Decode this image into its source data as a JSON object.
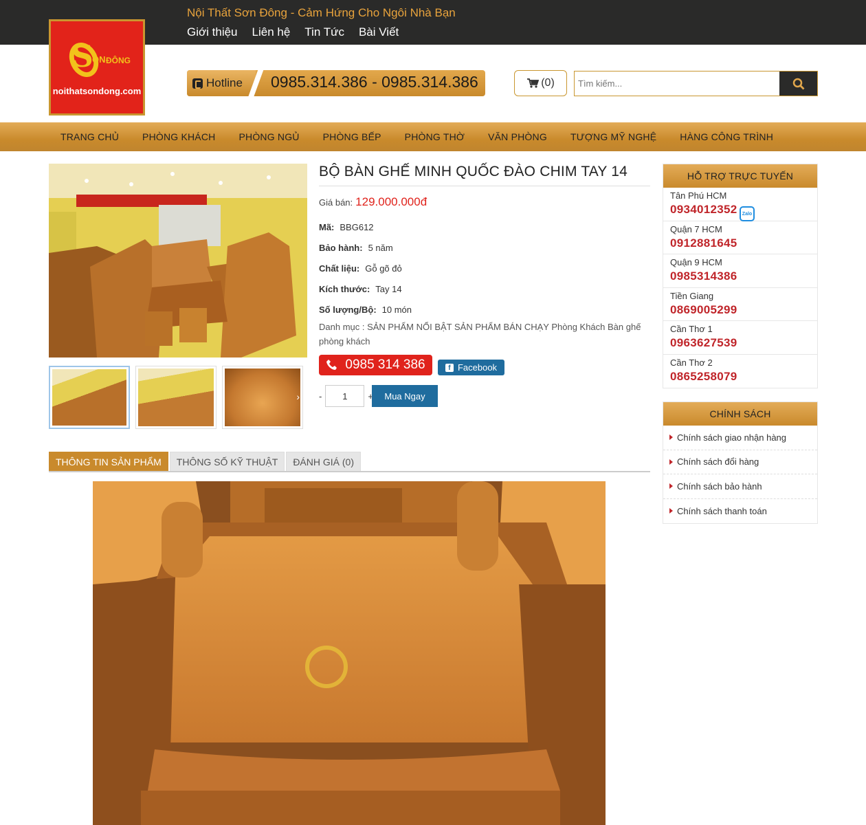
{
  "header": {
    "tagline": "Nội Thất Sơn Đông - Cảm Hứng Cho Ngôi Nhà Bạn",
    "top_links": [
      "Giới thiệu",
      "Liên hệ",
      "Tin Tức",
      "Bài Viết"
    ],
    "logo": {
      "brand_s": "S",
      "brand_on": "ON",
      "brand_dong": "ĐÔNG",
      "site": "noithatsondong.com"
    },
    "hotline_label": "Hotline",
    "hotline_numbers": "0985.314.386 - 0985.314.386",
    "cart_count": "(0)",
    "search_placeholder": "Tìm kiếm..."
  },
  "main_nav": [
    "TRANG CHỦ",
    "PHÒNG KHÁCH",
    "PHÒNG NGỦ",
    "PHÒNG BẾP",
    "PHÒNG THỜ",
    "VĂN PHÒNG",
    "TƯỢNG MỸ NGHỆ",
    "HÀNG CÔNG TRÌNH"
  ],
  "product": {
    "title": "BỘ BÀN GHẾ MINH QUỐC ĐÀO CHIM TAY 14",
    "price_label": "Giá bán:",
    "price": "129.000.000đ",
    "attributes": [
      {
        "key": "Mã:",
        "value": "BBG612"
      },
      {
        "key": "Bảo hành:",
        "value": "5 năm"
      },
      {
        "key": "Chất liệu:",
        "value": "Gỗ gõ đỏ"
      },
      {
        "key": "Kích thước:",
        "value": "Tay 14"
      },
      {
        "key": "Số lượng/Bộ:",
        "value": "10 món"
      }
    ],
    "category_text": "Danh mục : SẢN PHẨM NỔI BẬT SẢN PHẨM BÁN CHẠY Phòng Khách Bàn ghế phòng khách",
    "call_button": "0985 314 386",
    "facebook_button": "Facebook",
    "qty_minus": "-",
    "qty_value": "1",
    "qty_plus": "+",
    "buy_button": "Mua Ngay"
  },
  "tabs": [
    "THÔNG TIN SẢN PHẨM",
    "THÔNG SỐ KỸ THUẬT",
    "ĐÁNH GIÁ (0)"
  ],
  "support": {
    "title": "HỖ TRỢ TRỰC TUYẾN",
    "zalo_label": "Zalo",
    "items": [
      {
        "region": "Tân Phú HCM",
        "phone": "0934012352"
      },
      {
        "region": "Quận 7 HCM",
        "phone": "0912881645"
      },
      {
        "region": "Quận 9 HCM",
        "phone": "0985314386"
      },
      {
        "region": "Tiền Giang",
        "phone": "0869005299"
      },
      {
        "region": "Cần Thơ 1",
        "phone": "0963627539"
      },
      {
        "region": "Cần Thơ 2",
        "phone": "0865258079"
      }
    ]
  },
  "policy": {
    "title": "CHÍNH SÁCH",
    "items": [
      "Chính sách giao nhận hàng",
      "Chính sách đổi hàng",
      "Chính sách bảo hành",
      "Chính sách thanh toán"
    ]
  },
  "colors": {
    "gold": "#c98a2c",
    "dark": "#2a2a29",
    "red": "#e0231c",
    "blue": "#1f6c9e"
  }
}
